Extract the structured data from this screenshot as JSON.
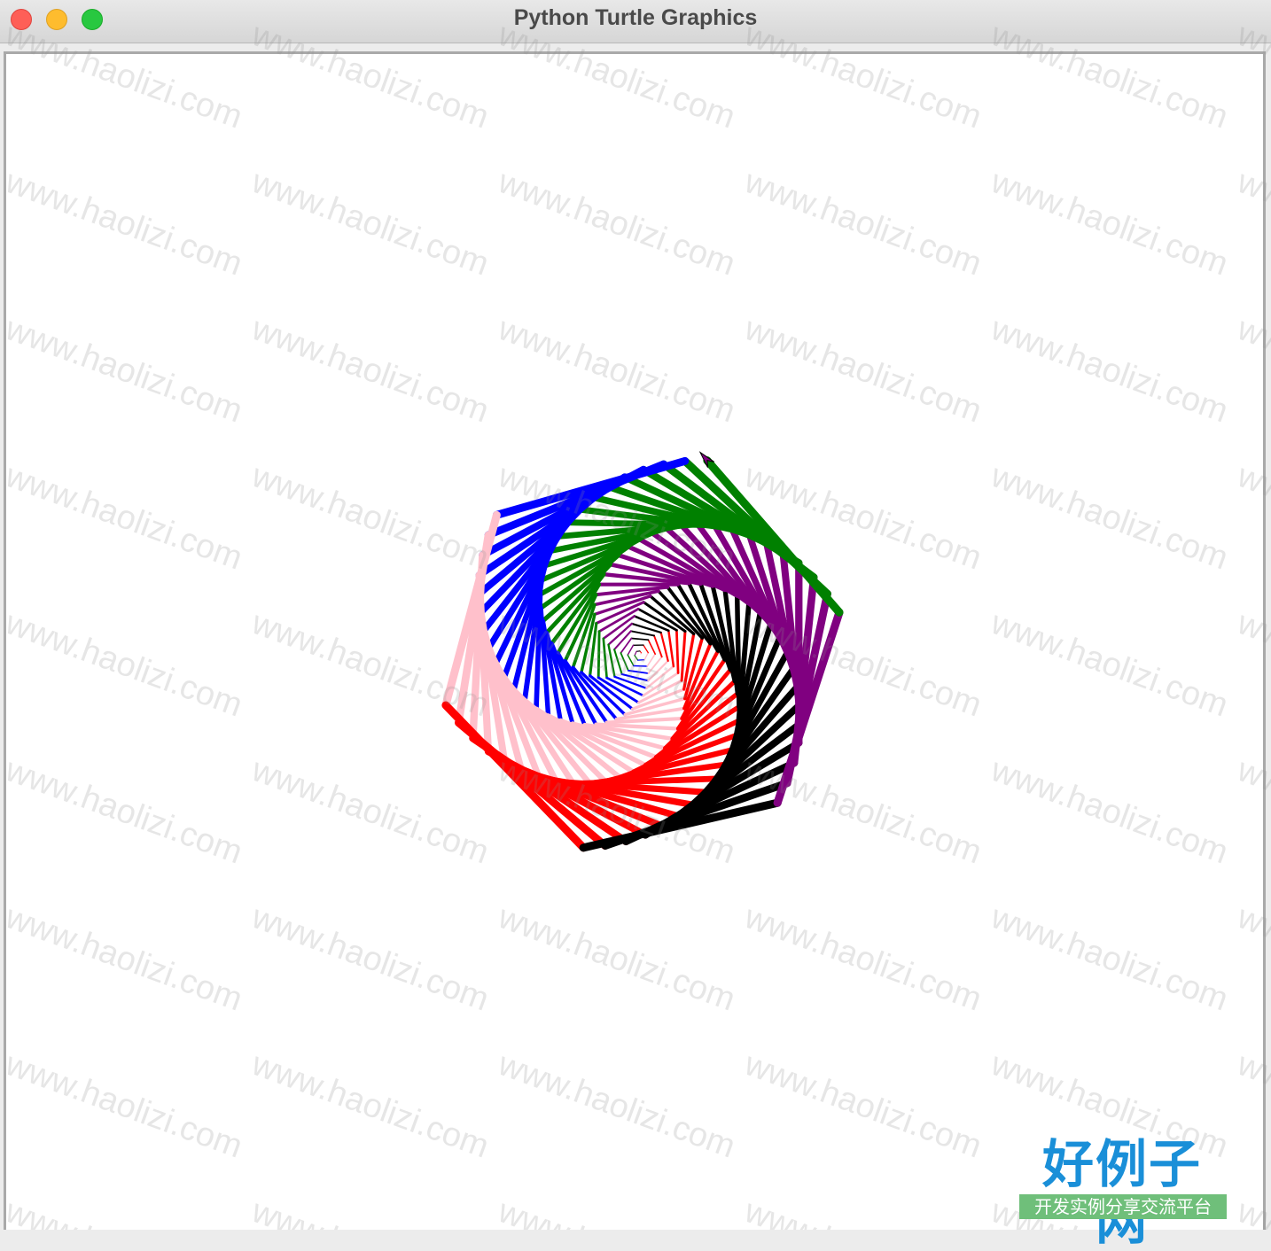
{
  "window": {
    "title": "Python Turtle Graphics"
  },
  "colors": {
    "background": "#ffffff",
    "pen_colors": [
      "blue",
      "pink",
      "red",
      "black",
      "purple",
      "green"
    ]
  },
  "icons": {
    "close": "close-dot",
    "minimize": "minimize-dot",
    "maximize": "zoom-dot",
    "cursor": "turtle-arrow"
  },
  "watermark": {
    "text": "www.haolizi.com"
  },
  "logo": {
    "main": "好例子网",
    "sub": "开发实例分享交流平台"
  }
}
